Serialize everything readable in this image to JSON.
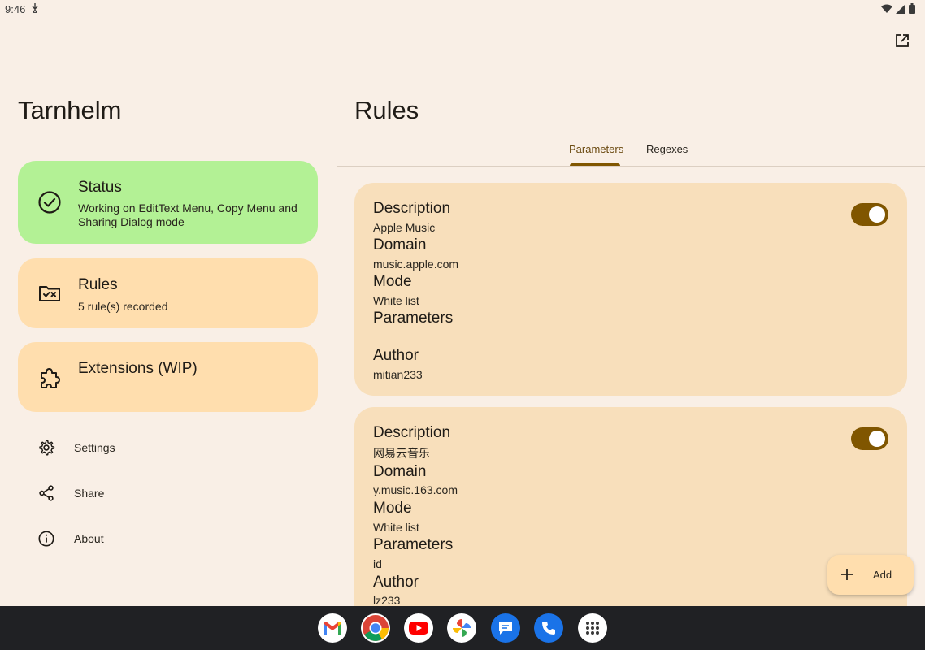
{
  "statusbar": {
    "time": "9:46"
  },
  "sidebar": {
    "app_title": "Tarnhelm",
    "cards": {
      "status": {
        "title": "Status",
        "subtitle": "Working on EditText Menu, Copy Menu and Sharing Dialog mode",
        "color": "#b3f195"
      },
      "rules": {
        "title": "Rules",
        "subtitle": "5 rule(s) recorded",
        "color": "#ffdeae"
      },
      "extensions": {
        "title": "Extensions (WIP)",
        "color": "#ffdeae"
      }
    },
    "menu": {
      "settings": "Settings",
      "share": "Share",
      "about": "About"
    }
  },
  "main": {
    "title": "Rules",
    "tabs": {
      "parameters": "Parameters",
      "regexes": "Regexes"
    },
    "rules": [
      {
        "description_label": "Description",
        "description": "Apple Music",
        "domain_label": "Domain",
        "domain": "music.apple.com",
        "mode_label": "Mode",
        "mode": "White list",
        "parameters_label": "Parameters",
        "parameters": "",
        "author_label": "Author",
        "author": "mitian233",
        "enabled": true
      },
      {
        "description_label": "Description",
        "description": "网易云音乐",
        "domain_label": "Domain",
        "domain": "y.music.163.com",
        "mode_label": "Mode",
        "mode": "White list",
        "parameters_label": "Parameters",
        "parameters": "id",
        "author_label": "Author",
        "author": "lz233",
        "enabled": true
      }
    ],
    "fab": {
      "label": "Add"
    }
  },
  "taskbar": {
    "apps": [
      "gmail-icon",
      "chrome-icon",
      "youtube-icon",
      "photos-icon",
      "messages-icon",
      "phone-icon",
      "app-drawer-icon"
    ]
  },
  "colors": {
    "accent": "#805600",
    "background": "#f9efe6",
    "card": "#f8dfbb"
  }
}
